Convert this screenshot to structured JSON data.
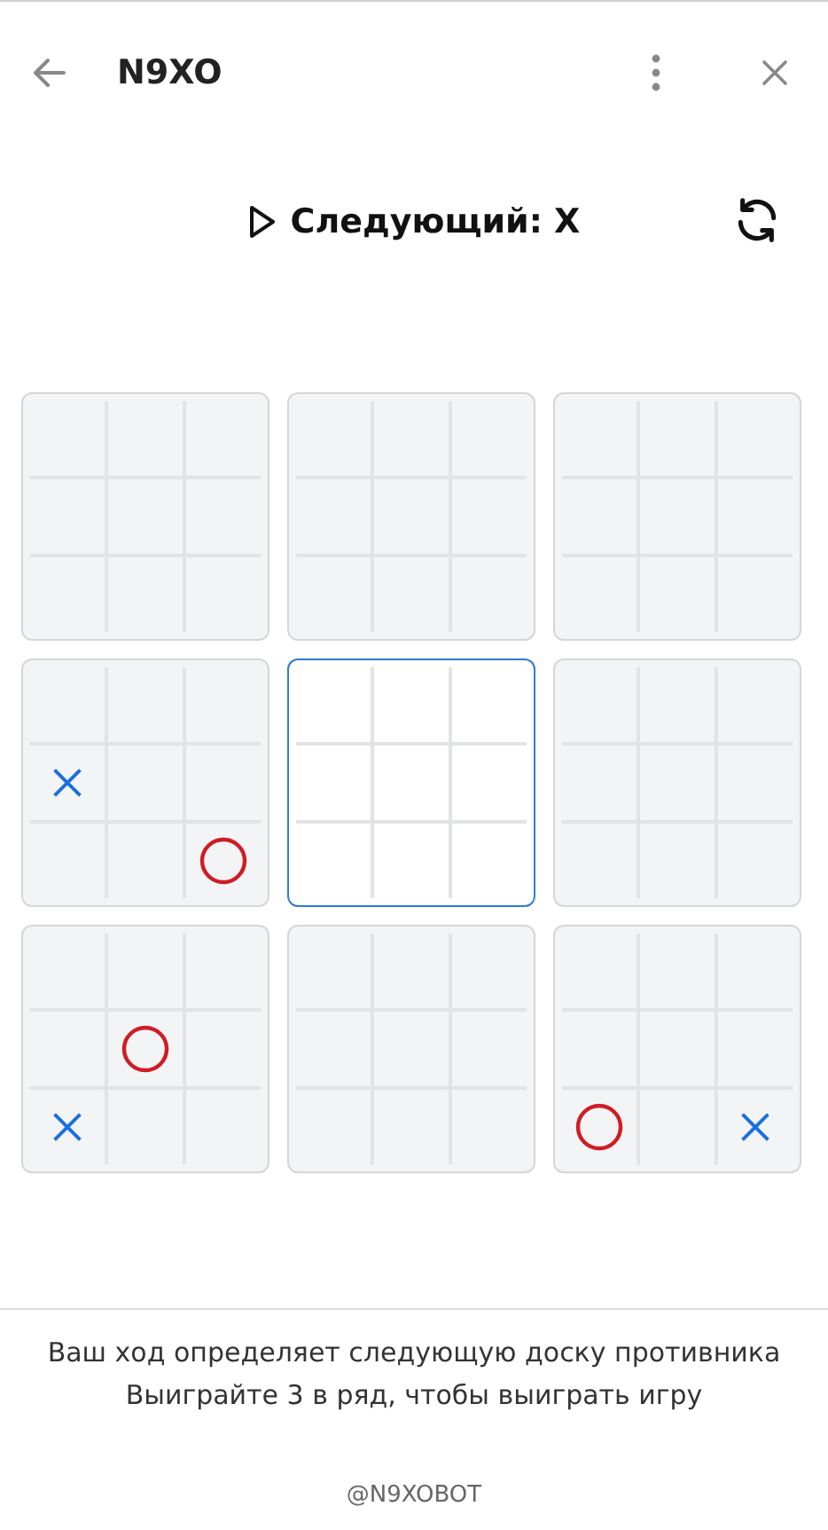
{
  "header": {
    "title": "N9XO"
  },
  "status": {
    "text": "Следующий: X"
  },
  "boards": [
    {
      "active": false,
      "cells": [
        {
          "kind": "empty"
        },
        {
          "kind": "empty"
        },
        {
          "kind": "empty"
        },
        {
          "kind": "empty"
        },
        {
          "kind": "empty"
        },
        {
          "kind": "empty"
        },
        {
          "kind": "empty"
        },
        {
          "kind": "empty"
        },
        {
          "kind": "empty"
        }
      ]
    },
    {
      "active": false,
      "cells": [
        {
          "kind": "empty"
        },
        {
          "kind": "empty"
        },
        {
          "kind": "empty"
        },
        {
          "kind": "empty"
        },
        {
          "kind": "empty"
        },
        {
          "kind": "empty"
        },
        {
          "kind": "empty"
        },
        {
          "kind": "empty"
        },
        {
          "kind": "empty"
        }
      ]
    },
    {
      "active": false,
      "cells": [
        {
          "kind": "empty"
        },
        {
          "kind": "empty"
        },
        {
          "kind": "empty"
        },
        {
          "kind": "empty"
        },
        {
          "kind": "empty"
        },
        {
          "kind": "empty"
        },
        {
          "kind": "empty"
        },
        {
          "kind": "empty"
        },
        {
          "kind": "empty"
        }
      ]
    },
    {
      "active": false,
      "cells": [
        {
          "kind": "empty"
        },
        {
          "kind": "empty"
        },
        {
          "kind": "empty"
        },
        {
          "kind": "x"
        },
        {
          "kind": "empty"
        },
        {
          "kind": "empty"
        },
        {
          "kind": "empty"
        },
        {
          "kind": "empty"
        },
        {
          "kind": "o"
        }
      ]
    },
    {
      "active": true,
      "cells": [
        {
          "kind": "empty"
        },
        {
          "kind": "empty"
        },
        {
          "kind": "empty"
        },
        {
          "kind": "empty"
        },
        {
          "kind": "empty"
        },
        {
          "kind": "empty"
        },
        {
          "kind": "empty"
        },
        {
          "kind": "empty"
        },
        {
          "kind": "empty"
        }
      ]
    },
    {
      "active": false,
      "cells": [
        {
          "kind": "empty"
        },
        {
          "kind": "empty"
        },
        {
          "kind": "empty"
        },
        {
          "kind": "empty"
        },
        {
          "kind": "empty"
        },
        {
          "kind": "empty"
        },
        {
          "kind": "empty"
        },
        {
          "kind": "empty"
        },
        {
          "kind": "empty"
        }
      ]
    },
    {
      "active": false,
      "cells": [
        {
          "kind": "empty"
        },
        {
          "kind": "empty"
        },
        {
          "kind": "empty"
        },
        {
          "kind": "empty"
        },
        {
          "kind": "o"
        },
        {
          "kind": "empty"
        },
        {
          "kind": "x"
        },
        {
          "kind": "empty"
        },
        {
          "kind": "empty"
        }
      ]
    },
    {
      "active": false,
      "cells": [
        {
          "kind": "empty"
        },
        {
          "kind": "empty"
        },
        {
          "kind": "empty"
        },
        {
          "kind": "empty"
        },
        {
          "kind": "empty"
        },
        {
          "kind": "empty"
        },
        {
          "kind": "empty"
        },
        {
          "kind": "empty"
        },
        {
          "kind": "empty"
        }
      ]
    },
    {
      "active": false,
      "cells": [
        {
          "kind": "empty"
        },
        {
          "kind": "empty"
        },
        {
          "kind": "empty"
        },
        {
          "kind": "empty"
        },
        {
          "kind": "empty"
        },
        {
          "kind": "empty"
        },
        {
          "kind": "o"
        },
        {
          "kind": "empty"
        },
        {
          "kind": "x"
        }
      ]
    }
  ],
  "info": [
    "Ваш ход определяет следующую доску противника",
    "Выиграйте 3 в ряд, чтобы выиграть игру"
  ],
  "footer": "@N9XOBOT"
}
